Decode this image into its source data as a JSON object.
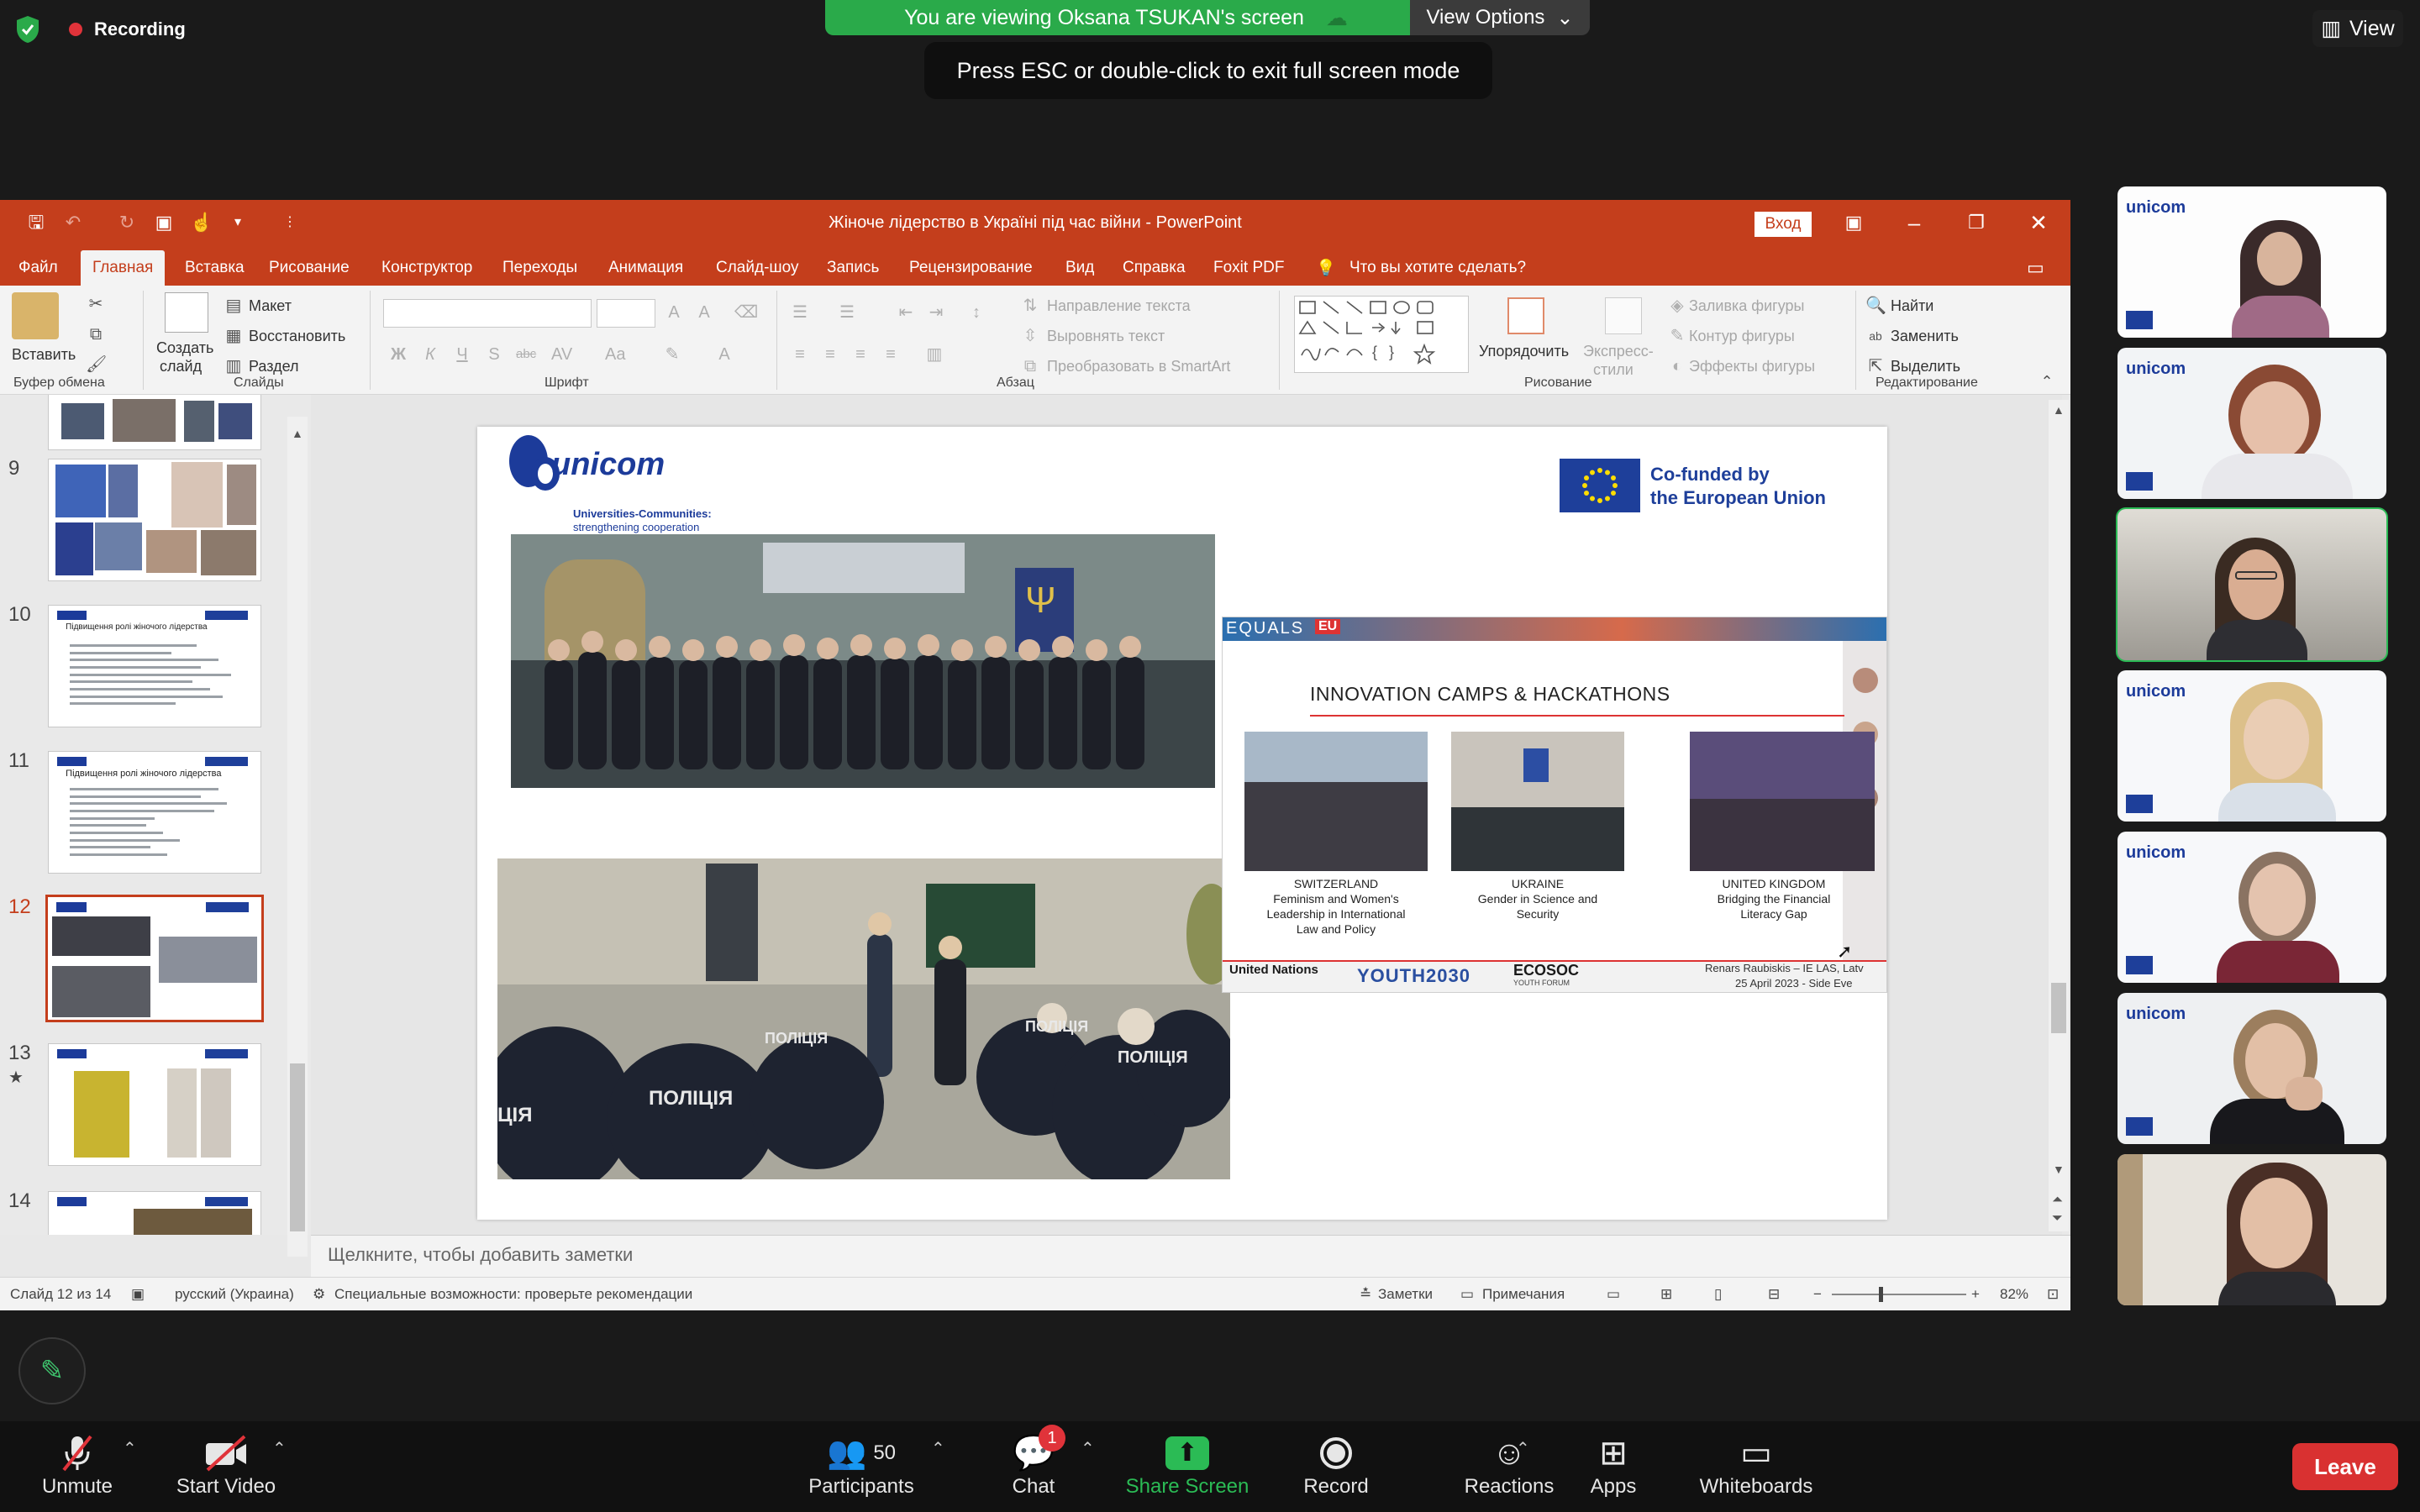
{
  "zoom": {
    "recording_label": "Recording",
    "viewing_banner": "You are viewing Oksana TSUKAN's screen",
    "view_options": "View Options",
    "esc_message": "Press ESC or double-click to exit full screen mode",
    "view_button": "View",
    "colors": {
      "banner": "#2aaa4a",
      "leave": "#d93131",
      "active_speaker": "#2bbb55"
    }
  },
  "ppt": {
    "window_title": "Жіноче лідерство в Україні під час війни  -  PowerPoint",
    "signin": "Вход",
    "tabs": [
      "Файл",
      "Главная",
      "Вставка",
      "Рисование",
      "Конструктор",
      "Переходы",
      "Анимация",
      "Слайд-шоу",
      "Запись",
      "Рецензирование",
      "Вид",
      "Справка",
      "Foxit PDF"
    ],
    "tell_me": "Что вы хотите сделать?",
    "ribbon": {
      "paste": "Вставить",
      "clipboard": "Буфер обмена",
      "new_slide_1": "Создать",
      "new_slide_2": "слайд",
      "layout": "Макет",
      "reset": "Восстановить",
      "section": "Раздел",
      "slides": "Слайды",
      "font": "Шрифт",
      "paragraph": "Абзац",
      "text_direction": "Направление текста",
      "align_text": "Выровнять текст",
      "smartart": "Преобразовать в SmartArt",
      "arrange": "Упорядочить",
      "quick_styles_1": "Экспресс-",
      "quick_styles_2": "стили",
      "shape_fill": "Заливка фигуры",
      "shape_outline": "Контур фигуры",
      "shape_effects": "Эффекты фигуры",
      "drawing": "Рисование",
      "find": "Найти",
      "replace": "Заменить",
      "select": "Выделить",
      "editing": "Редактирование"
    },
    "thumbnails": [
      {
        "num": "9"
      },
      {
        "num": "10"
      },
      {
        "num": "11"
      },
      {
        "num": "12"
      },
      {
        "num": "13"
      },
      {
        "num": "14"
      }
    ],
    "thumb10_title": "Підвищення ролі жіночого лідерства",
    "thumb11_title": "Підвищення ролі жіночого лідерства",
    "slide": {
      "logo_text": "unicom",
      "logo_sub1": "Universities-Communities:",
      "logo_sub2": "strengthening cooperation",
      "eu_line1": "Co-funded by",
      "eu_line2": "the European Union",
      "equals": "EQUALS",
      "equals_eu": "EU",
      "camp_title": "INNOVATION CAMPS & HACKATHONS",
      "camps": [
        {
          "country": "SWITZERLAND",
          "line1": "Feminism and Women's",
          "line2": "Leadership in International",
          "line3": "Law and Policy"
        },
        {
          "country": "UKRAINE",
          "line1": "Gender in Science and",
          "line2": "Security",
          "line3": ""
        },
        {
          "country": "UNITED KINGDOM",
          "line1": "Bridging the Financial",
          "line2": "Literacy Gap",
          "line3": ""
        }
      ],
      "footer_un": "United Nations",
      "footer_youth": "YOUTH2030",
      "footer_ecosoc": "ECOSOC",
      "footer_ecosoc_sub": "YOUTH FORUM",
      "footer_speaker": "Renars Raubiskis – IE LAS, Latv",
      "footer_date": "25 April 2023 - Side Eve",
      "police_text": "ПОЛІЦІЯ",
      "police_text_short": "ЦІЯ"
    },
    "notes_placeholder": "Щелкните, чтобы добавить заметки",
    "status": {
      "slide_count": "Слайд 12 из 14",
      "language": "русский (Украина)",
      "accessibility": "Специальные возможности: проверьте рекомендации",
      "notes": "Заметки",
      "comments": "Примечания",
      "zoom": "82%"
    }
  },
  "toolbar": {
    "unmute": "Unmute",
    "start_video": "Start Video",
    "participants": "Participants",
    "participants_count": "50",
    "chat": "Chat",
    "chat_badge": "1",
    "share_screen": "Share Screen",
    "record": "Record",
    "reactions": "Reactions",
    "apps": "Apps",
    "whiteboards": "Whiteboards",
    "leave": "Leave"
  },
  "participant_tiles": [
    {
      "logo": "unicom"
    },
    {
      "logo": "unicom"
    },
    {
      "logo": ""
    },
    {
      "logo": "unicom"
    },
    {
      "logo": "unicom"
    },
    {
      "logo": "unicom"
    },
    {
      "logo": ""
    }
  ]
}
